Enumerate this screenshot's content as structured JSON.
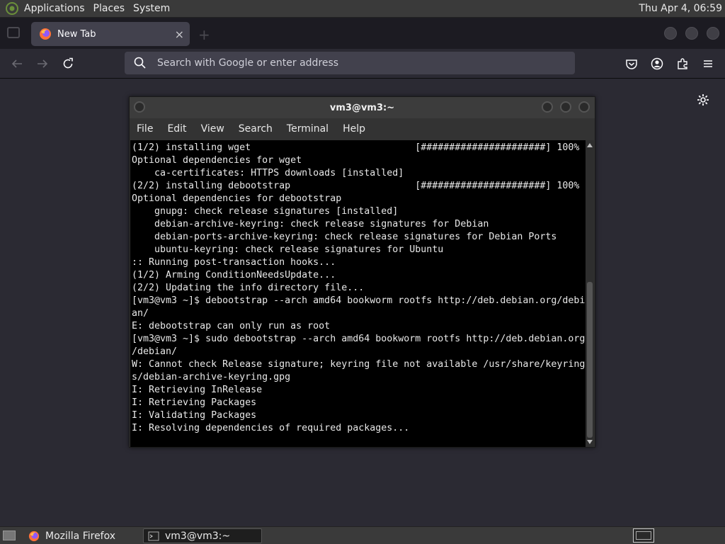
{
  "top_panel": {
    "menus": [
      "Applications",
      "Places",
      "System"
    ],
    "clock": "Thu Apr  4, 06:59"
  },
  "browser": {
    "tab_title": "New Tab",
    "tab_close": "×",
    "new_tab": "+",
    "url_placeholder": "Search with Google or enter address"
  },
  "terminal": {
    "title": "vm3@vm3:~",
    "menu": [
      "File",
      "Edit",
      "View",
      "Search",
      "Terminal",
      "Help"
    ],
    "lines": [
      "(1/2) installing wget                             [######################] 100%",
      "Optional dependencies for wget",
      "    ca-certificates: HTTPS downloads [installed]",
      "(2/2) installing debootstrap                      [######################] 100%",
      "Optional dependencies for debootstrap",
      "    gnupg: check release signatures [installed]",
      "    debian-archive-keyring: check release signatures for Debian",
      "    debian-ports-archive-keyring: check release signatures for Debian Ports",
      "    ubuntu-keyring: check release signatures for Ubuntu",
      ":: Running post-transaction hooks...",
      "(1/2) Arming ConditionNeedsUpdate...",
      "(2/2) Updating the info directory file...",
      "[vm3@vm3 ~]$ debootstrap --arch amd64 bookworm rootfs http://deb.debian.org/debi",
      "an/",
      "E: debootstrap can only run as root",
      "[vm3@vm3 ~]$ sudo debootstrap --arch amd64 bookworm rootfs http://deb.debian.org",
      "/debian/",
      "W: Cannot check Release signature; keyring file not available /usr/share/keyring",
      "s/debian-archive-keyring.gpg",
      "I: Retrieving InRelease",
      "I: Retrieving Packages",
      "I: Validating Packages",
      "I: Resolving dependencies of required packages..."
    ]
  },
  "taskbar": {
    "items": [
      "Mozilla Firefox",
      "vm3@vm3:~"
    ]
  }
}
